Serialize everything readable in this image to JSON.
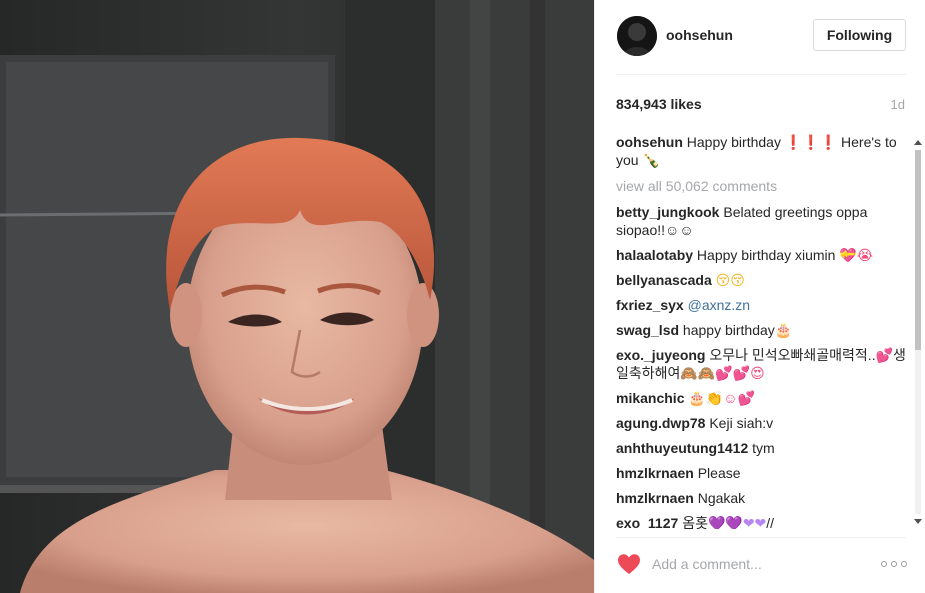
{
  "post": {
    "username": "oohsehun",
    "follow_label": "Following",
    "likes": "834,943 likes",
    "time": "1d",
    "caption_user": "oohsehun",
    "caption_text": "Happy birthday",
    "caption_marks": "❗❗❗",
    "caption_text2": "Here's to you",
    "caption_emoji": "🍾",
    "view_all": "view all 50,062 comments"
  },
  "comments": [
    {
      "user": "betty_jungkook",
      "text": "Belated greetings oppa siopao!!☺☺"
    },
    {
      "user": "halaalotaby",
      "text": "Happy birthday xiumin",
      "emoji": "💝😭"
    },
    {
      "user": "bellyanascada",
      "emoji": "😚😚"
    },
    {
      "user": "fxriez_syx",
      "mention": "@axnz.zn"
    },
    {
      "user": "swag_lsd",
      "text": "happy birthday",
      "emoji": "🎂"
    },
    {
      "user": "exo._juyeong",
      "text": "오무나 민석오빠쇄골매력적..",
      "emoji": "💕",
      "text2": "생일축하해여",
      "emoji2": "🙈🙈💕💕😍"
    },
    {
      "user": "mikanchic",
      "emoji": "🎂👏☺💕"
    },
    {
      "user": "agung.dwp78",
      "text": "Keji siah:v"
    },
    {
      "user": "anhthuyeutung1412",
      "text": "tym"
    },
    {
      "user": "hmzlkrnaen",
      "text": "Please"
    },
    {
      "user": "hmzlkrnaen",
      "text": "Ngakak"
    },
    {
      "user": "exo_1127",
      "text": "옴홋",
      "emoji": "💜💜❤❤",
      "text2": "//"
    }
  ],
  "footer": {
    "add_comment_placeholder": "Add a comment...",
    "like_icon": "heart-icon",
    "more_icon": "more-options-icon"
  },
  "colors": {
    "accent_red": "#ed4956",
    "text": "#262626",
    "muted": "#a5a7aa",
    "link": "#3f729b"
  }
}
